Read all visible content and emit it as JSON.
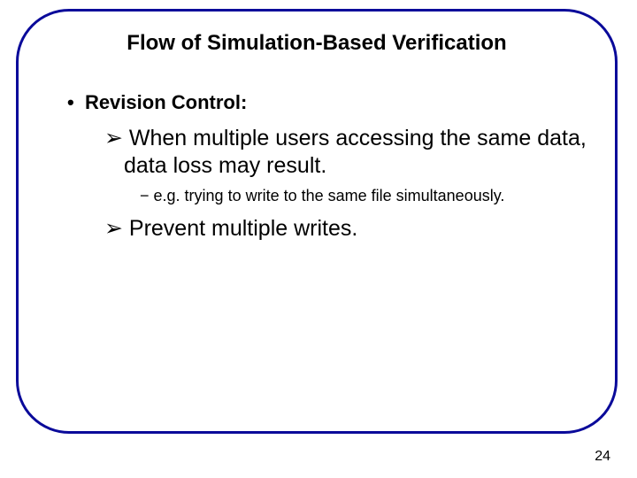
{
  "slide": {
    "title": "Flow of Simulation-Based Verification",
    "bullets": [
      {
        "marker": "•",
        "text": "Revision Control:",
        "children": [
          {
            "marker": "➢",
            "text": "When multiple users accessing the same data, data loss may result.",
            "children": [
              {
                "marker": "−",
                "text": "e.g. trying to write to the same file simultaneously."
              }
            ]
          },
          {
            "marker": "➢",
            "text": "Prevent multiple writes."
          }
        ]
      }
    ],
    "page_number": "24"
  }
}
